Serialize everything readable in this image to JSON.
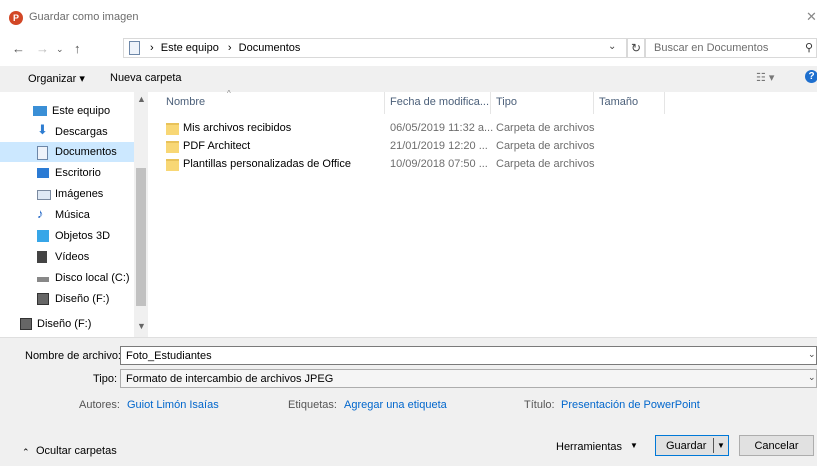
{
  "window": {
    "title": "Guardar como imagen",
    "app_icon": "P",
    "close_glyph": "✕"
  },
  "address": {
    "path": [
      "Este equipo",
      "Documentos"
    ],
    "sep": "›",
    "search_placeholder": "Buscar en Documentos"
  },
  "toolbar": {
    "organize": "Organizar ▾",
    "new_folder": "Nueva carpeta"
  },
  "sidebar": {
    "items": [
      {
        "label": "Este equipo",
        "icon": "pc-icon"
      },
      {
        "label": "Descargas",
        "icon": "download-icon"
      },
      {
        "label": "Documentos",
        "icon": "documents-icon",
        "selected": true
      },
      {
        "label": "Escritorio",
        "icon": "desktop-icon"
      },
      {
        "label": "Imágenes",
        "icon": "pictures-icon"
      },
      {
        "label": "Música",
        "icon": "music-icon"
      },
      {
        "label": "Objetos 3D",
        "icon": "objects3d-icon"
      },
      {
        "label": "Vídeos",
        "icon": "videos-icon"
      },
      {
        "label": "Disco local (C:)",
        "icon": "drive-icon"
      },
      {
        "label": "Diseño (F:)",
        "icon": "usb-drive-icon"
      },
      {
        "label": "Diseño (F:)",
        "icon": "usb-drive-icon"
      }
    ]
  },
  "columns": {
    "name": "Nombre",
    "date": "Fecha de modifica...",
    "type": "Tipo",
    "size": "Tamaño"
  },
  "files": [
    {
      "name": "Mis archivos recibidos",
      "date": "06/05/2019 11:32 a...",
      "type": "Carpeta de archivos"
    },
    {
      "name": "PDF Architect",
      "date": "21/01/2019 12:20 ...",
      "type": "Carpeta de archivos"
    },
    {
      "name": "Plantillas personalizadas de Office",
      "date": "10/09/2018 07:50 ...",
      "type": "Carpeta de archivos"
    }
  ],
  "form": {
    "filename_label": "Nombre de archivo:",
    "filename_value": "Foto_Estudiantes",
    "type_label": "Tipo:",
    "type_value": "Formato de intercambio de archivos JPEG",
    "authors_label": "Autores:",
    "authors_value": "Guiot Limón Isaías",
    "tags_label": "Etiquetas:",
    "tags_value": "Agregar una etiqueta",
    "title_label": "Título:",
    "title_value": "Presentación de PowerPoint"
  },
  "footer": {
    "hide_folders": "Ocultar carpetas",
    "tools": "Herramientas",
    "save": "Guardar",
    "cancel": "Cancelar"
  }
}
